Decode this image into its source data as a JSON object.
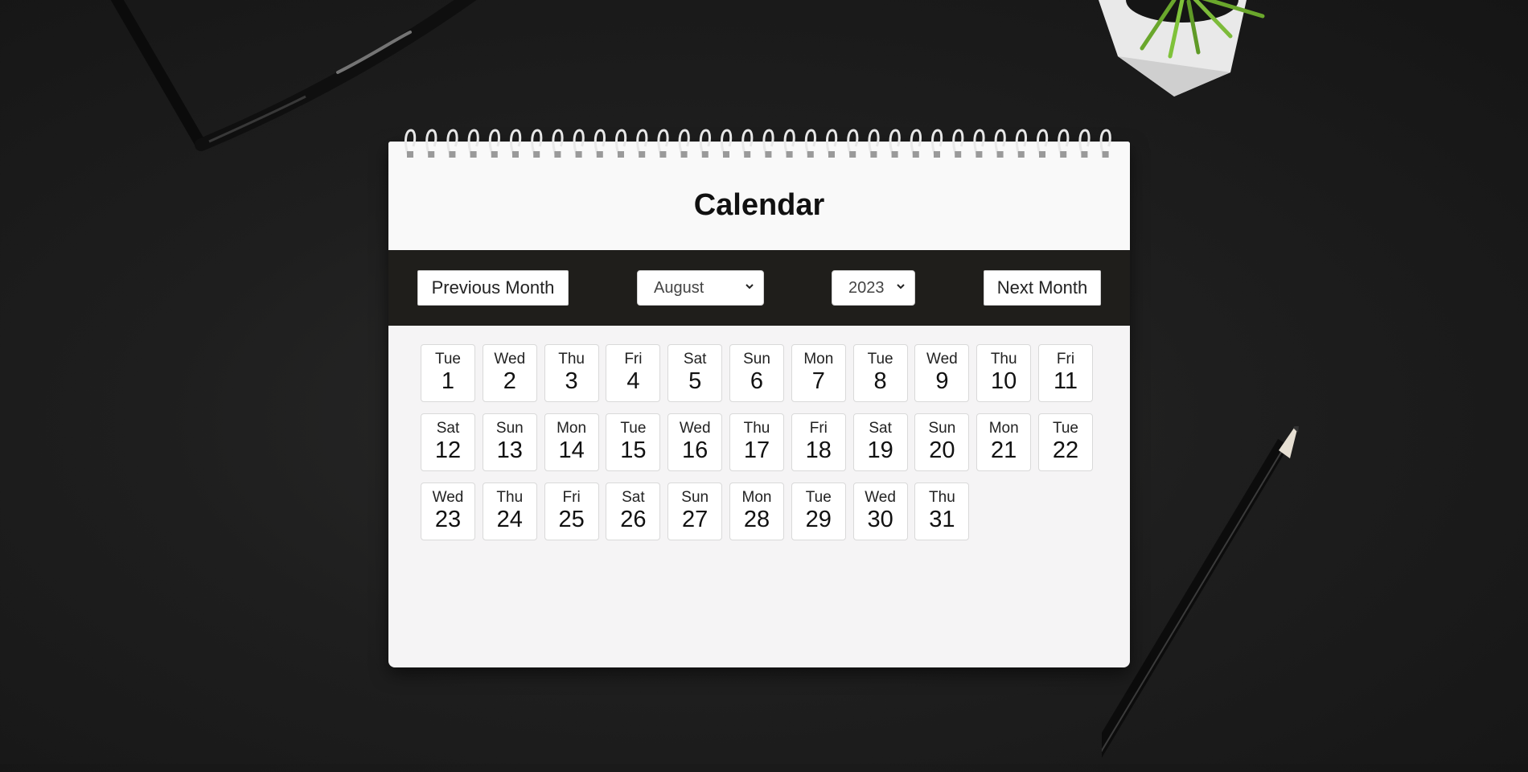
{
  "calendar": {
    "title": "Calendar",
    "prev_label": "Previous Month",
    "next_label": "Next Month",
    "month": "August",
    "year": "2023",
    "days": [
      {
        "dow": "Tue",
        "num": "1"
      },
      {
        "dow": "Wed",
        "num": "2"
      },
      {
        "dow": "Thu",
        "num": "3"
      },
      {
        "dow": "Fri",
        "num": "4"
      },
      {
        "dow": "Sat",
        "num": "5"
      },
      {
        "dow": "Sun",
        "num": "6"
      },
      {
        "dow": "Mon",
        "num": "7"
      },
      {
        "dow": "Tue",
        "num": "8"
      },
      {
        "dow": "Wed",
        "num": "9"
      },
      {
        "dow": "Thu",
        "num": "10"
      },
      {
        "dow": "Fri",
        "num": "11"
      },
      {
        "dow": "Sat",
        "num": "12"
      },
      {
        "dow": "Sun",
        "num": "13"
      },
      {
        "dow": "Mon",
        "num": "14"
      },
      {
        "dow": "Tue",
        "num": "15"
      },
      {
        "dow": "Wed",
        "num": "16"
      },
      {
        "dow": "Thu",
        "num": "17"
      },
      {
        "dow": "Fri",
        "num": "18"
      },
      {
        "dow": "Sat",
        "num": "19"
      },
      {
        "dow": "Sun",
        "num": "20"
      },
      {
        "dow": "Mon",
        "num": "21"
      },
      {
        "dow": "Tue",
        "num": "22"
      },
      {
        "dow": "Wed",
        "num": "23"
      },
      {
        "dow": "Thu",
        "num": "24"
      },
      {
        "dow": "Fri",
        "num": "25"
      },
      {
        "dow": "Sat",
        "num": "26"
      },
      {
        "dow": "Sun",
        "num": "27"
      },
      {
        "dow": "Mon",
        "num": "28"
      },
      {
        "dow": "Tue",
        "num": "29"
      },
      {
        "dow": "Wed",
        "num": "30"
      },
      {
        "dow": "Thu",
        "num": "31"
      }
    ]
  },
  "colors": {
    "background": "#1e1e1e",
    "card": "#f5f4f5",
    "toolbar": "#1f1e1b"
  }
}
